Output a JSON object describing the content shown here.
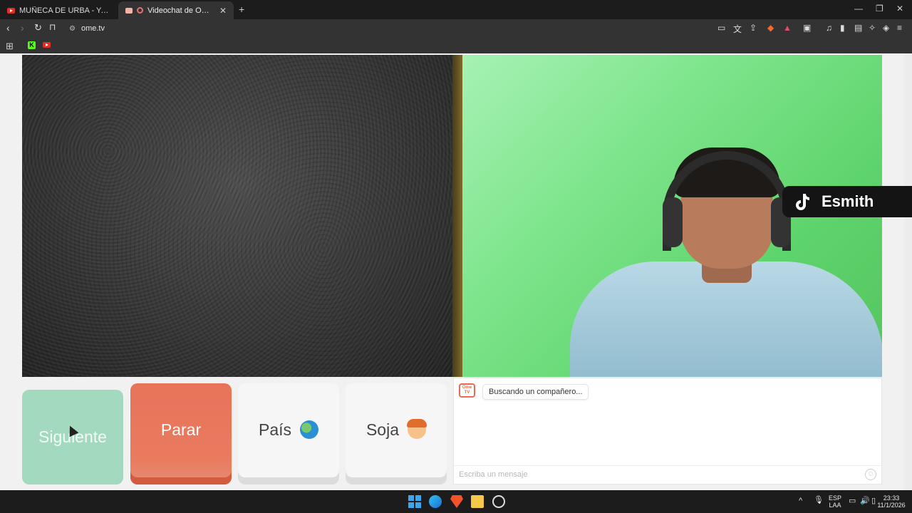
{
  "browser": {
    "tabs": [
      {
        "title": "MUÑECA DE URBA - YouTube",
        "active": false
      },
      {
        "title": "Videochat de OmeTV — Alter",
        "active": true
      }
    ],
    "new_tab": "+",
    "url": "ome.tv"
  },
  "video": {
    "overlay_name": "Esmith"
  },
  "controls": {
    "next_label": "Siguiente",
    "stop_label": "Parar",
    "country_label": "País",
    "gender_label": "Soja"
  },
  "chat": {
    "logo_text": "Ome TV",
    "status_message": "Buscando un compañero...",
    "input_placeholder": "Escriba un mensaje"
  },
  "taskbar": {
    "language_top": "ESP",
    "language_bottom": "LAA",
    "time": "23:33",
    "date": "11/1/2026"
  },
  "colors": {
    "next_button": "#a3d9be",
    "stop_button": "#e8735a",
    "brand": "#e96a4f"
  }
}
